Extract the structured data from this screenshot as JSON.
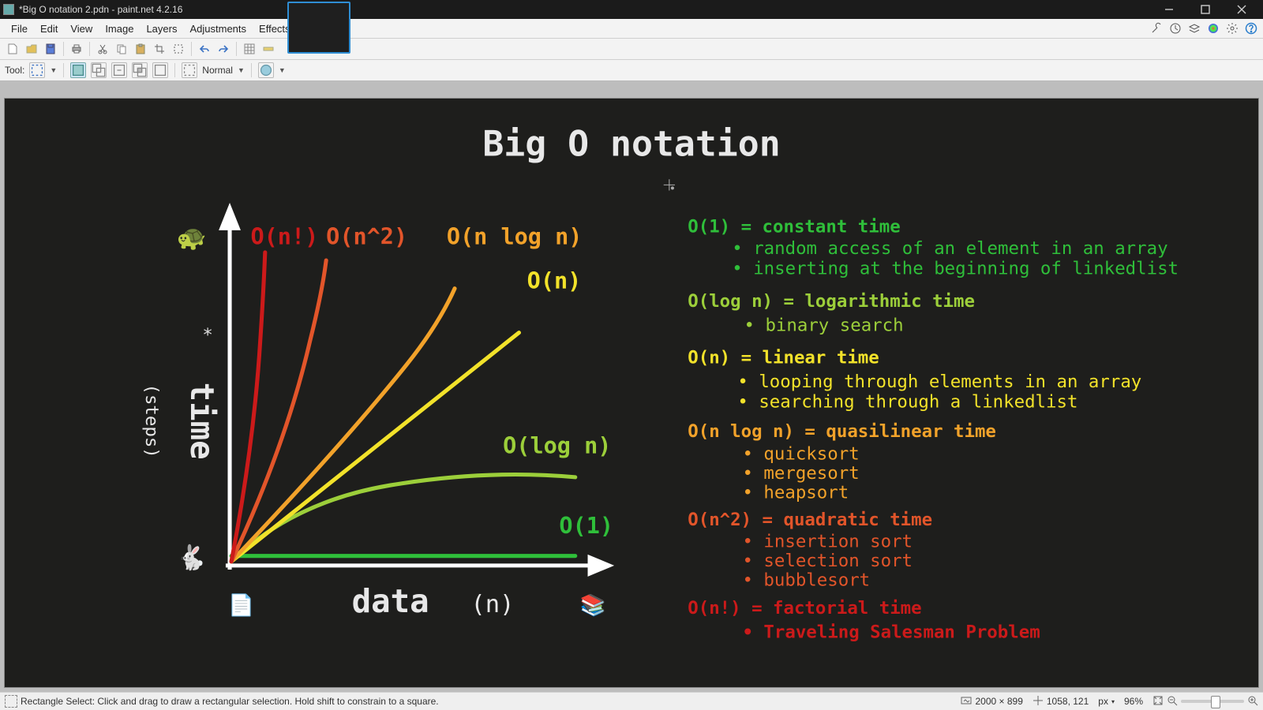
{
  "window": {
    "title": "*Big O notation 2.pdn - paint.net 4.2.16"
  },
  "menu": {
    "items": [
      "File",
      "Edit",
      "View",
      "Image",
      "Layers",
      "Adjustments",
      "Effects"
    ]
  },
  "tooloptions": {
    "label": "Tool:",
    "mode": "Normal"
  },
  "status": {
    "hint": "Rectangle Select: Click and drag to draw a rectangular selection. Hold shift to constrain to a square.",
    "image_size": "2000 × 899",
    "cursor_pos": "1058, 121",
    "unit": "px",
    "zoom": "96%"
  },
  "doc": {
    "title": "Big O notation",
    "ylabel_main": "time",
    "ylabel_sub": "(steps)",
    "xlabel_main": "data",
    "xlabel_sub": "(n)",
    "curves": {
      "fact": "O(n!)",
      "quad": "O(n^2)",
      "nlogn": "O(n log n)",
      "lin": "O(n)",
      "log": "O(log n)",
      "const": "O(1)"
    },
    "legend": {
      "o1": {
        "h": "O(1) = constant time",
        "b1": "random access of an element in an array",
        "b2": "inserting at the beginning of linkedlist"
      },
      "olog": {
        "h": "O(log n) = logarithmic time",
        "b1": "binary search"
      },
      "on": {
        "h": "O(n) = linear time",
        "b1": "looping through elements in an array",
        "b2": "searching through a linkedlist"
      },
      "onlogn": {
        "h": "O(n log n) = quasilinear time",
        "b1": "quicksort",
        "b2": "mergesort",
        "b3": "heapsort"
      },
      "on2": {
        "h": "O(n^2) = quadratic time",
        "b1": "insertion sort",
        "b2": "selection sort",
        "b3": "bubblesort"
      },
      "onf": {
        "h": "O(n!) = factorial time",
        "b1": "Traveling Salesman Problem"
      }
    },
    "icons": {
      "turtle": "🐢",
      "rabbit": "🐇",
      "doc": "📄",
      "books": "📚"
    }
  },
  "chart_data": {
    "type": "line",
    "title": "Big O notation",
    "xlabel": "data (n)",
    "ylabel": "time (steps)",
    "xlim": [
      0,
      10
    ],
    "ylim": [
      0,
      10
    ],
    "series": [
      {
        "name": "O(1)",
        "color": "#2fbf3a",
        "x": [
          0,
          10
        ],
        "y": [
          0.3,
          0.3
        ]
      },
      {
        "name": "O(log n)",
        "color": "#9ccf3a",
        "x": [
          0,
          1,
          2,
          4,
          6,
          8,
          10
        ],
        "y": [
          0,
          1.0,
          1.7,
          2.3,
          2.6,
          2.8,
          2.9
        ]
      },
      {
        "name": "O(n)",
        "color": "#f2e22a",
        "x": [
          0,
          10
        ],
        "y": [
          0,
          8.0
        ]
      },
      {
        "name": "O(n log n)",
        "color": "#f2a22a",
        "x": [
          0,
          2,
          4,
          6,
          7
        ],
        "y": [
          0,
          2.0,
          4.8,
          8.0,
          10
        ]
      },
      {
        "name": "O(n^2)",
        "color": "#e2552a",
        "x": [
          0,
          1,
          2,
          3,
          3.2
        ],
        "y": [
          0,
          1,
          4,
          9,
          10
        ]
      },
      {
        "name": "O(n!)",
        "color": "#cc1a1a",
        "x": [
          0,
          1,
          1.5,
          1.7
        ],
        "y": [
          0,
          1,
          6,
          10
        ]
      }
    ]
  }
}
